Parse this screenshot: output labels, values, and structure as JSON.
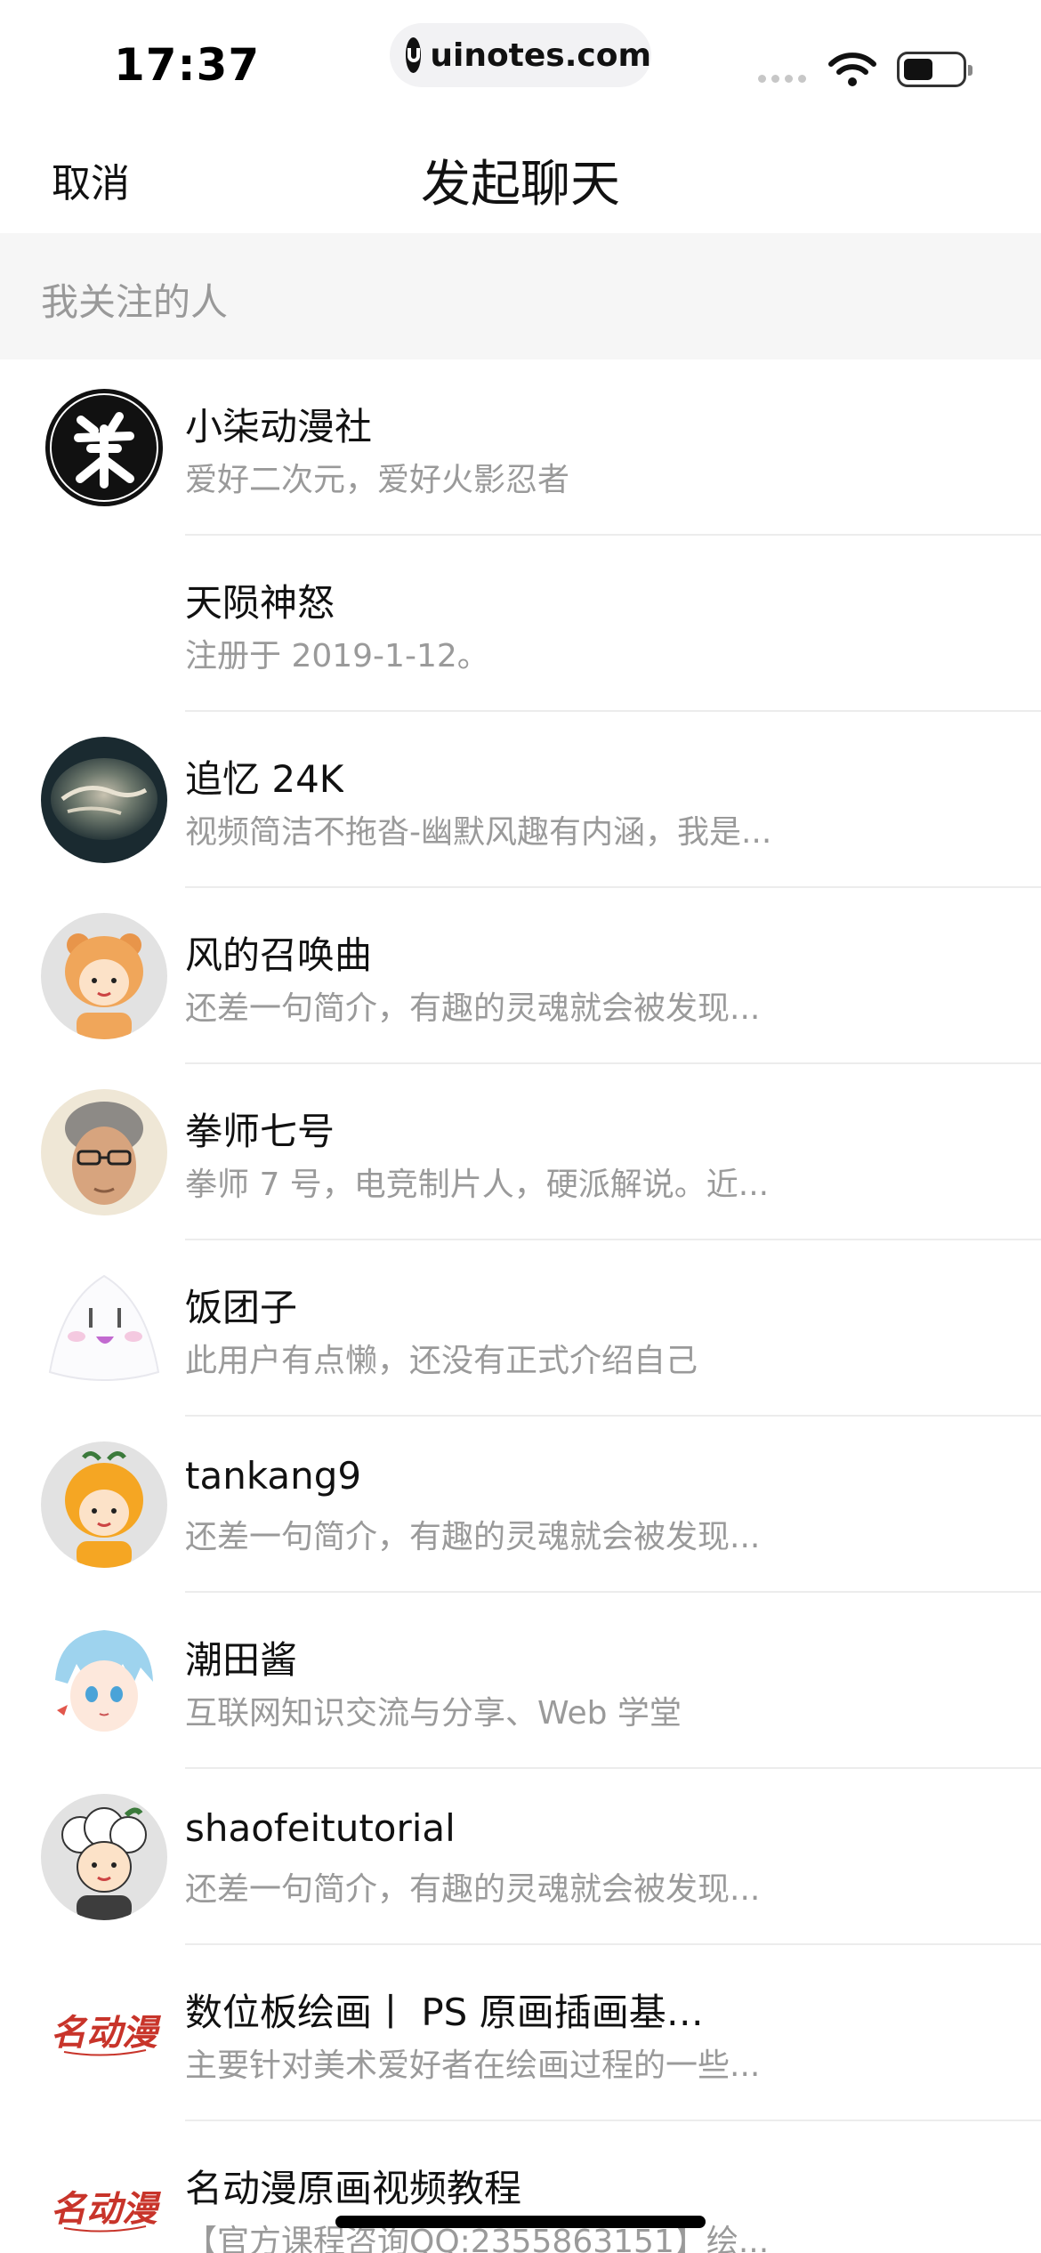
{
  "status_bar": {
    "time": "17:37",
    "url": "uinotes.com"
  },
  "nav": {
    "cancel_label": "取消",
    "title": "发起聊天"
  },
  "section": {
    "header": "我关注的人"
  },
  "contacts": [
    {
      "name": "小柒动漫社",
      "bio": "爱好二次元，爱好火影忍者",
      "avatar": "seal-chai"
    },
    {
      "name": "天陨神怒",
      "bio": "注册于 2019-1-12。",
      "avatar": "none"
    },
    {
      "name": "追忆 24K",
      "bio": "视频简洁不拖沓-幽默风趣有内涵，我是...",
      "avatar": "planet"
    },
    {
      "name": "风的召唤曲",
      "bio": "还差一句简介，有趣的灵魂就会被发现...",
      "avatar": "bear-costume-default"
    },
    {
      "name": "拳师七号",
      "bio": "拳师 7 号，电竞制片人，硬派解说。近...",
      "avatar": "photo-man-glasses"
    },
    {
      "name": "饭团子",
      "bio": "此用户有点懒，还没有正式介绍自己",
      "avatar": "rice-ball"
    },
    {
      "name": "tankang9",
      "bio": "还差一句简介，有趣的灵魂就会被发现...",
      "avatar": "orange-costume-default"
    },
    {
      "name": "潮田酱",
      "bio": "互联网知识交流与分享、Web 学堂",
      "avatar": "anime-boy"
    },
    {
      "name": "shaofeitutorial",
      "bio": "还差一句简介，有趣的灵魂就会被发现...",
      "avatar": "sheep-costume-default"
    },
    {
      "name": "数位板绘画丨 PS 原画插画基础...",
      "bio": "主要针对美术爱好者在绘画过程的一些...",
      "avatar": "mingdongman-logo"
    },
    {
      "name": "名动漫原画视频教程",
      "bio": "【官方课程咨询QQ:2355863151】绘...",
      "avatar": "mingdongman-logo"
    }
  ],
  "logo_text": "名动漫",
  "colors": {
    "section_bg": "#f6f6f6",
    "secondary_text": "#9a9a9a",
    "divider": "#ececec",
    "logo_red": "#c8342a"
  }
}
